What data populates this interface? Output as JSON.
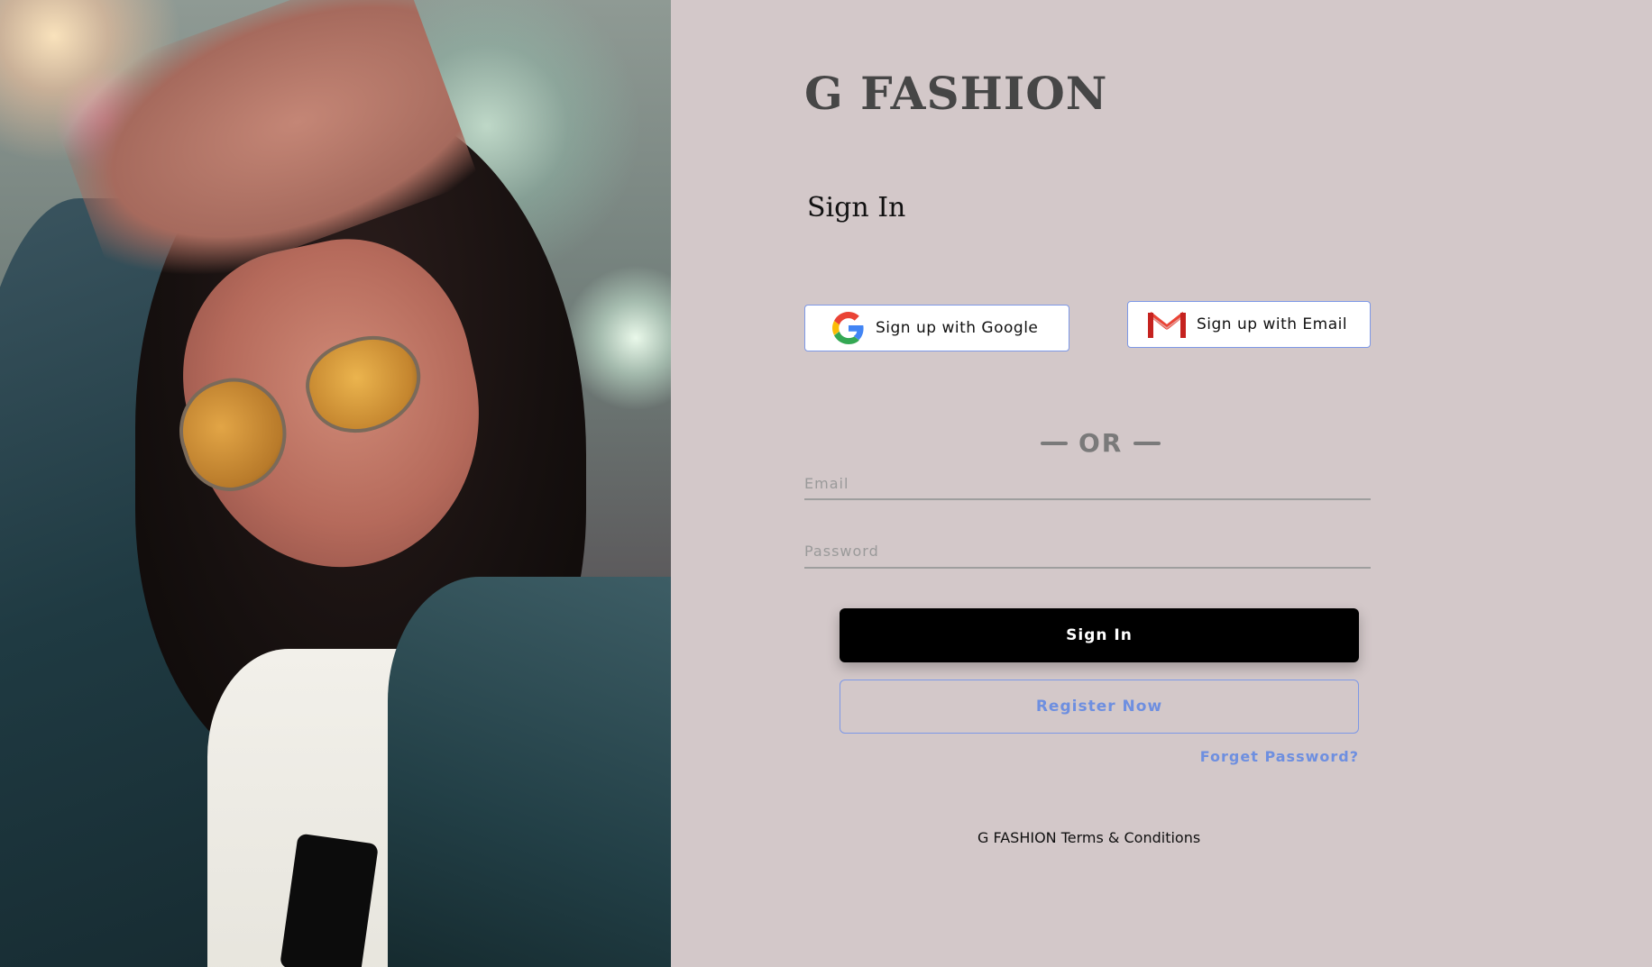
{
  "brand": {
    "name": "G FASHION"
  },
  "signin": {
    "title": "Sign In"
  },
  "social": {
    "google_label": "Sign up with Google",
    "email_label": "Sign up with Email"
  },
  "divider": {
    "text": "OR"
  },
  "form": {
    "email_placeholder": "Email",
    "password_placeholder": "Password",
    "signin_label": "Sign In",
    "register_label": "Register Now",
    "forgot_label": "Forget Password?"
  },
  "footer": {
    "terms_label": "G FASHION Terms & Conditions"
  },
  "colors": {
    "background": "#d3c8c9",
    "accent": "#6e8fe0",
    "primary_button": "#000000",
    "text_dark": "#464646"
  },
  "icons": {
    "google": "google-logo-icon",
    "gmail": "gmail-logo-icon"
  }
}
